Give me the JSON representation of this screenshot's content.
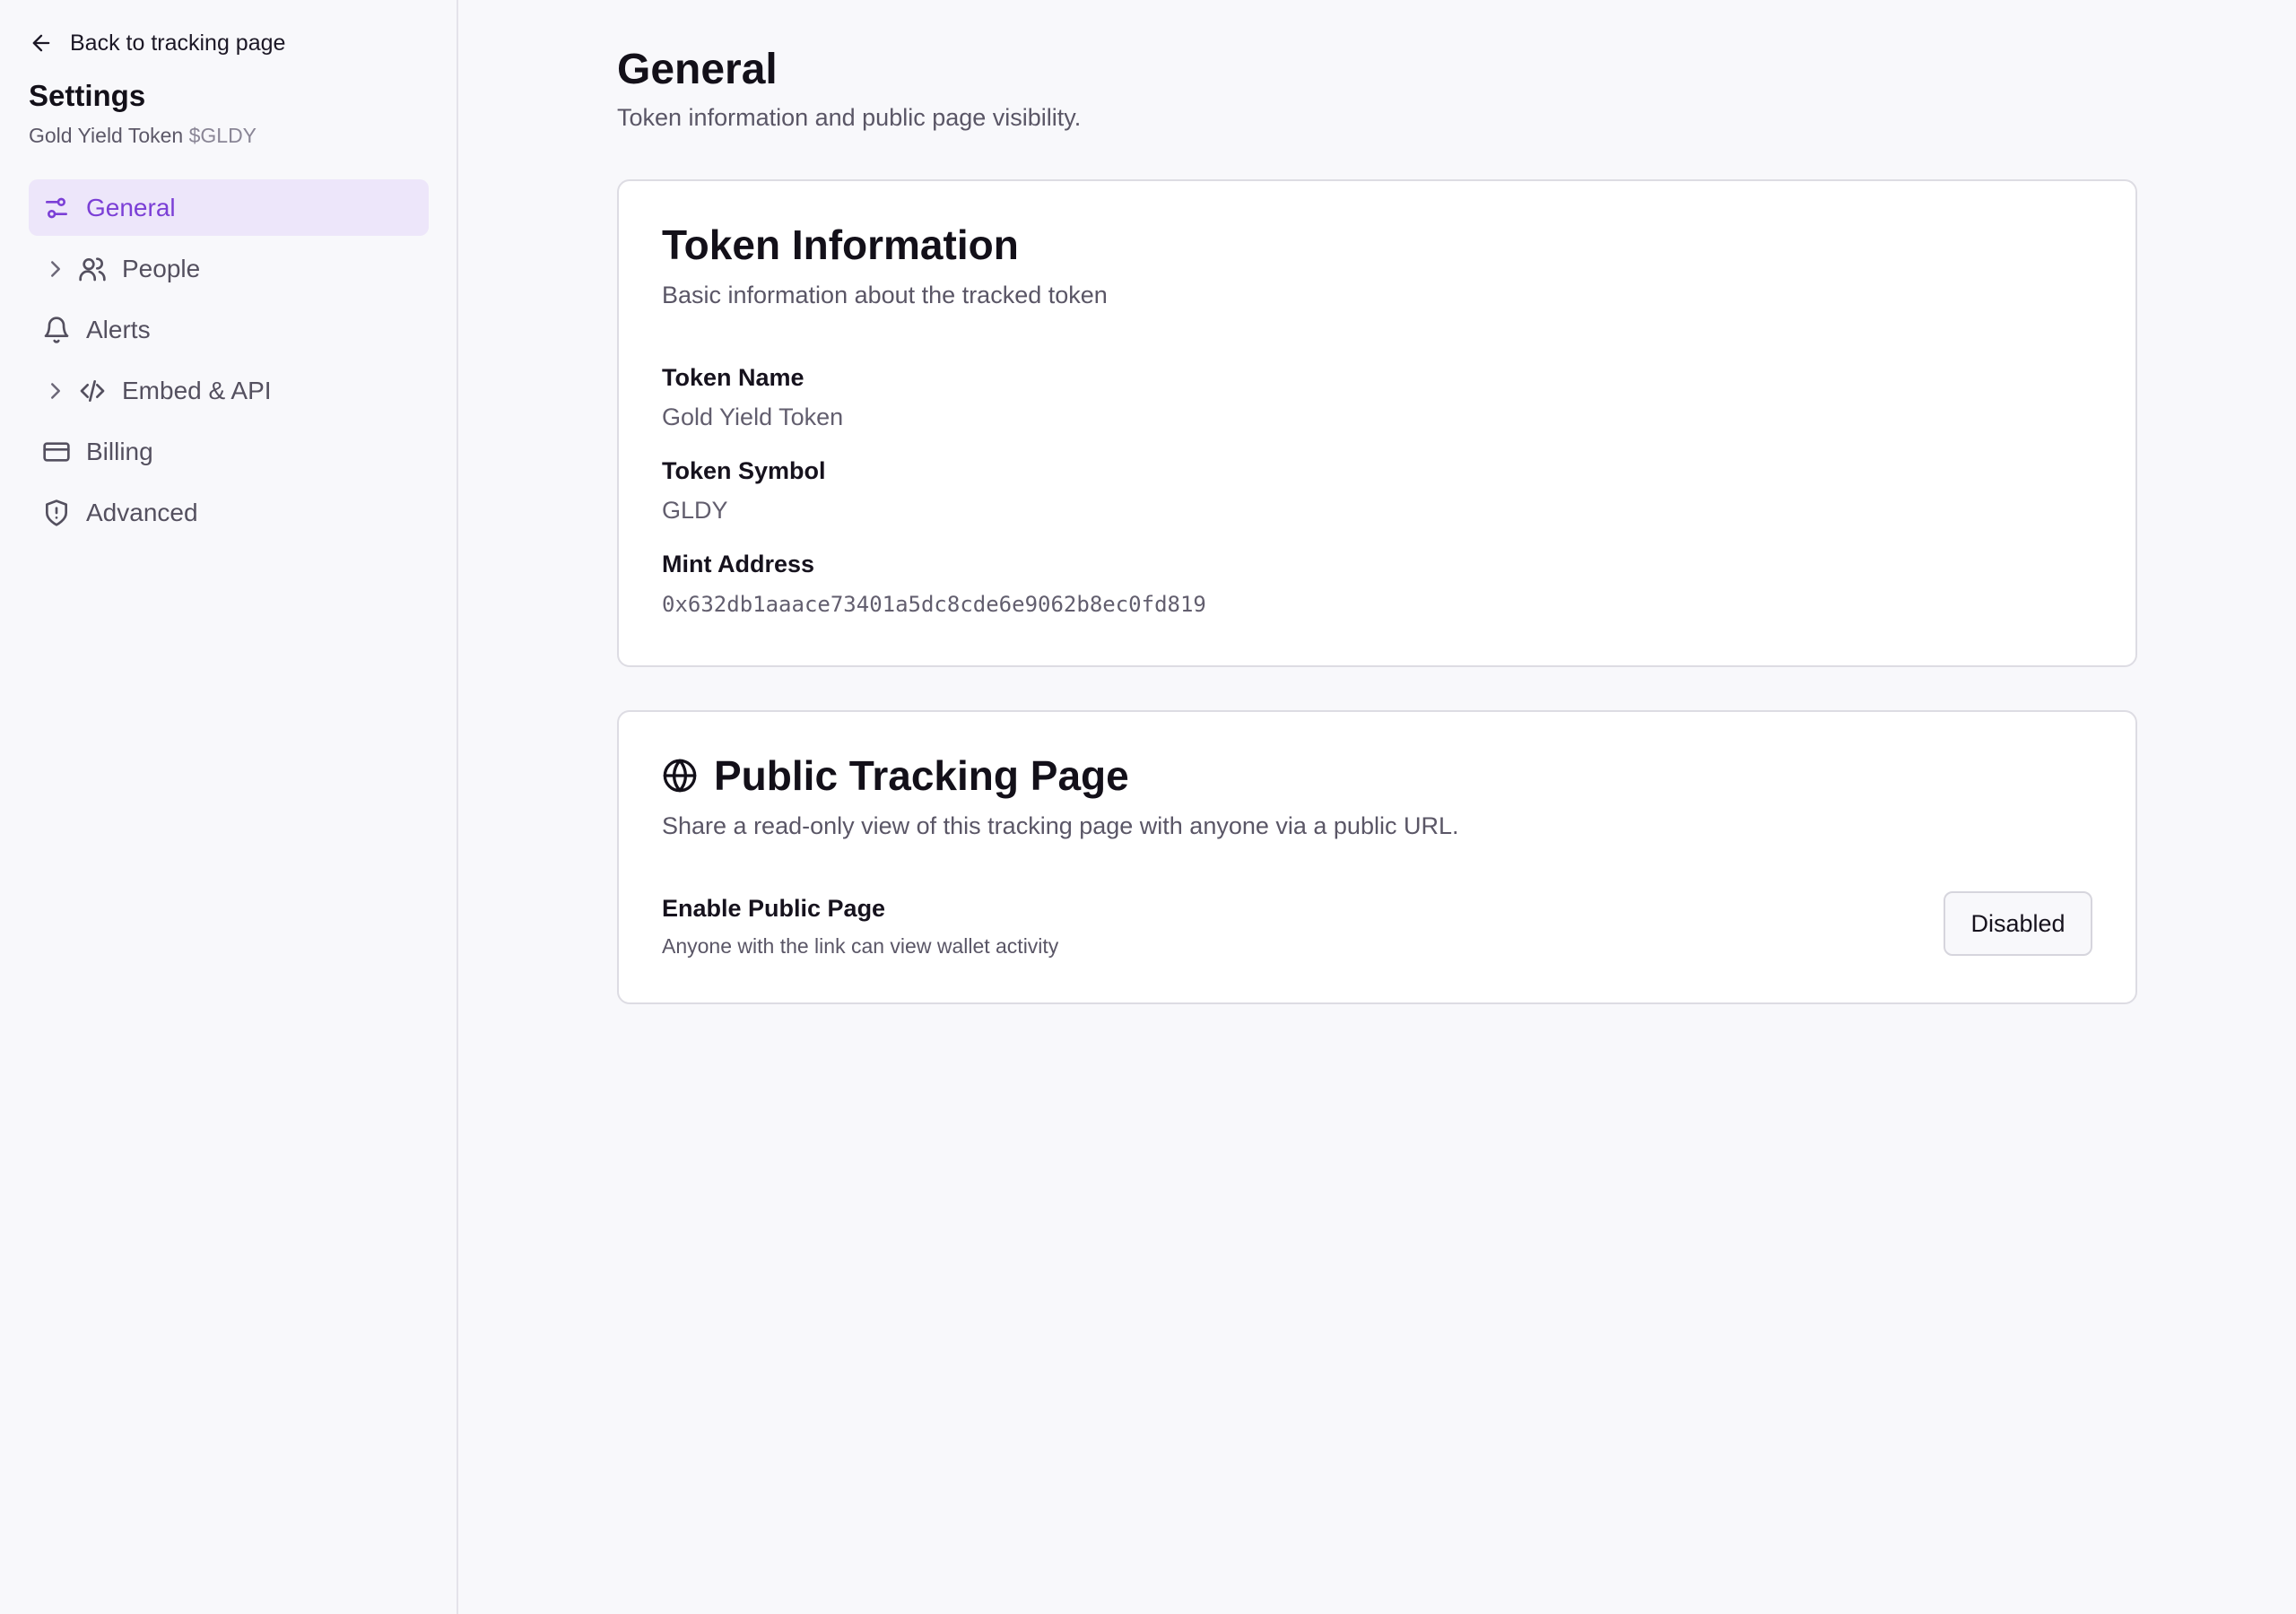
{
  "sidebar": {
    "back_label": "Back to tracking page",
    "title": "Settings",
    "token_name": "Gold Yield Token",
    "token_symbol": "$GLDY",
    "items": [
      {
        "label": "General",
        "icon": "sliders-icon",
        "active": true
      },
      {
        "label": "People",
        "icon": "users-icon",
        "expandable": true
      },
      {
        "label": "Alerts",
        "icon": "bell-icon"
      },
      {
        "label": "Embed & API",
        "icon": "code-icon",
        "expandable": true
      },
      {
        "label": "Billing",
        "icon": "credit-card-icon"
      },
      {
        "label": "Advanced",
        "icon": "shield-alert-icon"
      }
    ]
  },
  "main": {
    "title": "General",
    "subtitle": "Token information and public page visibility."
  },
  "token_info": {
    "title": "Token Information",
    "description": "Basic information about the tracked token",
    "fields": [
      {
        "label": "Token Name",
        "value": "Gold Yield Token"
      },
      {
        "label": "Token Symbol",
        "value": "GLDY"
      },
      {
        "label": "Mint Address",
        "value": "0x632db1aaace73401a5dc8cde6e9062b8ec0fd819"
      }
    ]
  },
  "public_page": {
    "title": "Public Tracking Page",
    "icon": "globe-icon",
    "description": "Share a read-only view of this tracking page with anyone via a public URL.",
    "setting_label": "Enable Public Page",
    "setting_hint": "Anyone with the link can view wallet activity",
    "toggle_label": "Disabled"
  },
  "colors": {
    "accent": "#7b3fd6",
    "active_bg": "#ede6fa",
    "background": "#f8f8fb",
    "card": "#ffffff"
  }
}
